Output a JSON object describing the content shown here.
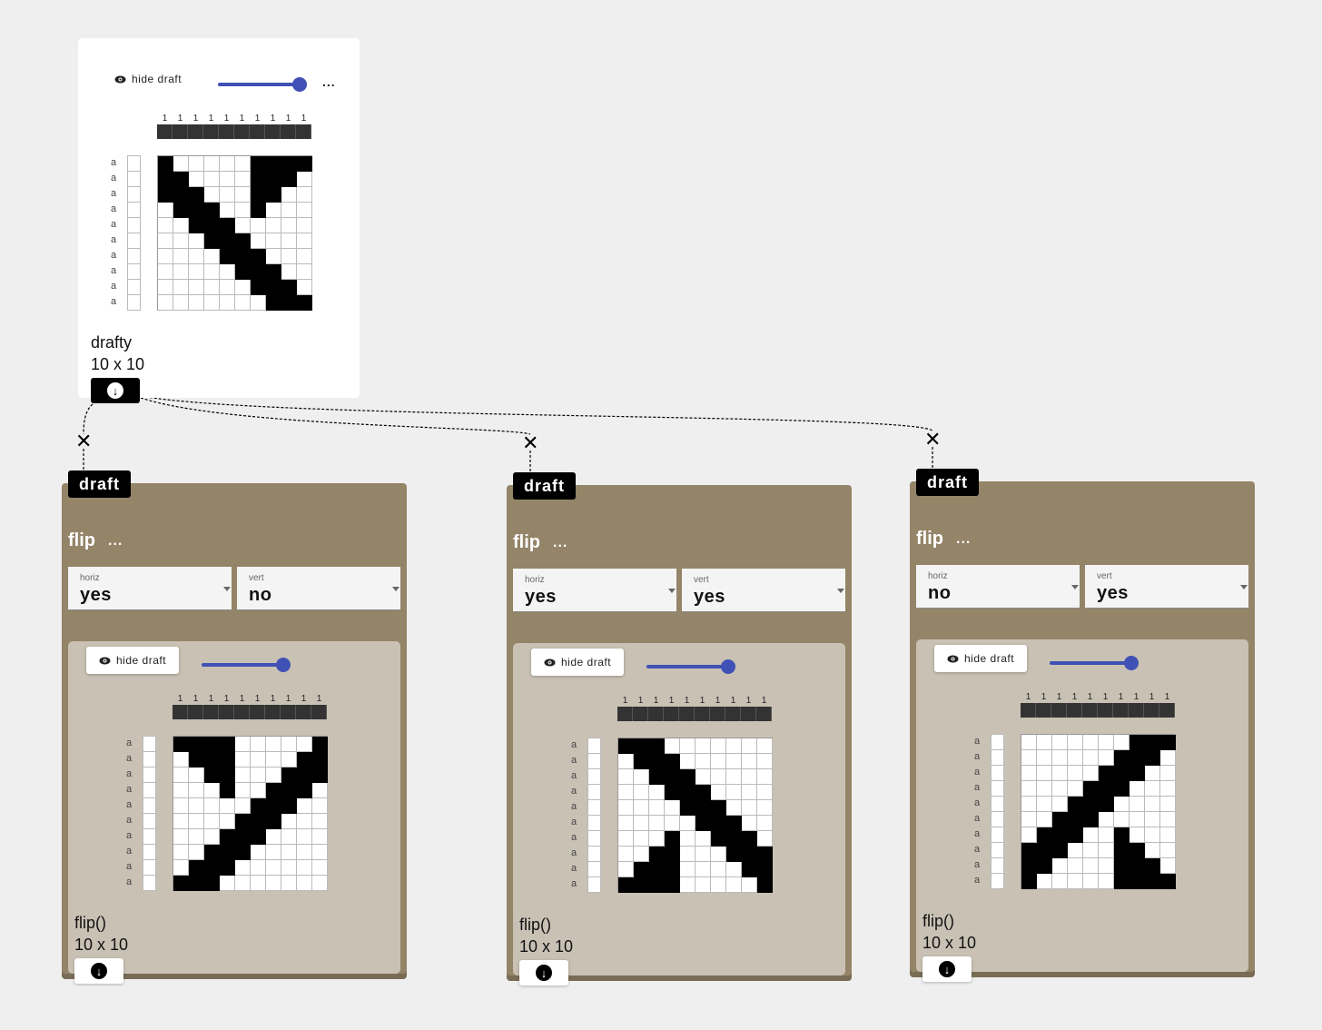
{
  "top_draft": {
    "hide_label": "hide draft",
    "more_label": "...",
    "warp_numbers": [
      "1",
      "1",
      "1",
      "1",
      "1",
      "1",
      "1",
      "1",
      "1",
      "1"
    ],
    "weft_label": "a",
    "name": "drafty",
    "size": "10 x 10",
    "pattern": [
      "1000001111",
      "1100001110",
      "1110001100",
      "0111001000",
      "0011100000",
      "0001110000",
      "0000111000",
      "0000011100",
      "0000001110",
      "0000000111"
    ]
  },
  "connector_x": "✕",
  "ops": [
    {
      "tag": "draft",
      "title": "flip",
      "more": "...",
      "horiz_label": "horiz",
      "horiz_value": "yes",
      "vert_label": "vert",
      "vert_value": "no",
      "hide_label": "hide draft",
      "warp_numbers": [
        "1",
        "1",
        "1",
        "1",
        "1",
        "1",
        "1",
        "1",
        "1",
        "1"
      ],
      "weft_label": "a",
      "name": "flip()",
      "size": "10 x 10",
      "pattern": [
        "1111000001",
        "0111000011",
        "0011000111",
        "0001001110",
        "0000011100",
        "0000111000",
        "0001110000",
        "0011100000",
        "0111000000",
        "1110000000"
      ]
    },
    {
      "tag": "draft",
      "title": "flip",
      "more": "...",
      "horiz_label": "horiz",
      "horiz_value": "yes",
      "vert_label": "vert",
      "vert_value": "yes",
      "hide_label": "hide draft",
      "warp_numbers": [
        "1",
        "1",
        "1",
        "1",
        "1",
        "1",
        "1",
        "1",
        "1",
        "1"
      ],
      "weft_label": "a",
      "name": "flip()",
      "size": "10 x 10",
      "pattern": [
        "1110000000",
        "0111000000",
        "0011100000",
        "0001110000",
        "0000111000",
        "0000011100",
        "0001001110",
        "0011000111",
        "0111000011",
        "1111000001"
      ]
    },
    {
      "tag": "draft",
      "title": "flip",
      "more": "...",
      "horiz_label": "horiz",
      "horiz_value": "no",
      "vert_label": "vert",
      "vert_value": "yes",
      "hide_label": "hide draft",
      "warp_numbers": [
        "1",
        "1",
        "1",
        "1",
        "1",
        "1",
        "1",
        "1",
        "1",
        "1"
      ],
      "weft_label": "a",
      "name": "flip()",
      "size": "10 x 10",
      "pattern": [
        "0000000111",
        "0000001110",
        "0000011100",
        "0000111000",
        "0001110000",
        "0011100000",
        "0111001000",
        "1110001100",
        "1100001110",
        "1000001111"
      ]
    }
  ]
}
